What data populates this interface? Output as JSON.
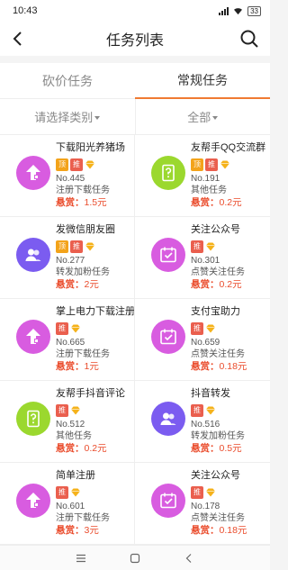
{
  "status": {
    "time": "10:43",
    "battery": "33"
  },
  "navbar": {
    "title": "任务列表"
  },
  "tabs": [
    {
      "label": "砍价任务",
      "active": false
    },
    {
      "label": "常规任务",
      "active": true
    }
  ],
  "filters": {
    "category": "请选择类别",
    "scope": "全部"
  },
  "reward_prefix": "悬赏：",
  "badge_labels": {
    "top": "顶",
    "push": "推"
  },
  "tasks": [
    {
      "name": "下载阳光养猪场",
      "top": true,
      "push": true,
      "no": "No.445",
      "type": "注册下载任务",
      "reward": "1.5元",
      "icon": "upload-icon"
    },
    {
      "name": "友帮手QQ交流群",
      "top": true,
      "push": true,
      "no": "No.191",
      "type": "其他任务",
      "reward": "0.2元",
      "icon": "question-doc-icon"
    },
    {
      "name": "发微信朋友圈",
      "top": true,
      "push": true,
      "no": "No.277",
      "type": "转发加粉任务",
      "reward": "2元",
      "icon": "users-icon"
    },
    {
      "name": "关注公众号",
      "top": false,
      "push": true,
      "no": "No.301",
      "type": "点赞关注任务",
      "reward": "0.2元",
      "icon": "calendar-check-icon"
    },
    {
      "name": "掌上电力下载注册",
      "top": false,
      "push": true,
      "no": "No.665",
      "type": "注册下载任务",
      "reward": "1元",
      "icon": "upload-icon"
    },
    {
      "name": "支付宝助力",
      "top": false,
      "push": true,
      "no": "No.659",
      "type": "点赞关注任务",
      "reward": "0.18元",
      "icon": "calendar-check-icon"
    },
    {
      "name": "友帮手抖音评论",
      "top": false,
      "push": true,
      "no": "No.512",
      "type": "其他任务",
      "reward": "0.2元",
      "icon": "question-doc-icon"
    },
    {
      "name": "抖音转发",
      "top": false,
      "push": true,
      "no": "No.516",
      "type": "转发加粉任务",
      "reward": "0.5元",
      "icon": "users-icon"
    },
    {
      "name": "简单注册",
      "top": false,
      "push": true,
      "no": "No.601",
      "type": "注册下载任务",
      "reward": "3元",
      "icon": "upload-icon"
    },
    {
      "name": "关注公众号",
      "top": false,
      "push": true,
      "no": "No.178",
      "type": "点赞关注任务",
      "reward": "0.18元",
      "icon": "calendar-check-icon"
    }
  ],
  "colors": {
    "accent": "#f07a32",
    "reward": "#ea4c2c",
    "upload-icon": "#d85ce0",
    "question-doc-icon": "#9bd82e",
    "users-icon": "#7b5cf0",
    "calendar-check-icon": "#d85ce0"
  }
}
